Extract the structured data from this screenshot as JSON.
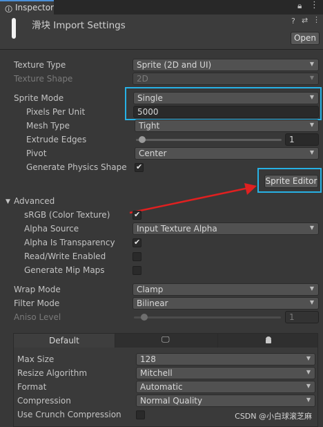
{
  "tab": {
    "label": "Inspector",
    "icon": "info-icon"
  },
  "header": {
    "title": "滑块 Import Settings",
    "open_label": "Open",
    "help_icon": "?",
    "settings_icon": "⇄",
    "menu_icon": "⋮"
  },
  "general": [
    {
      "label": "Texture Type",
      "value": "Sprite (2D and UI)"
    },
    {
      "label": "Texture Shape",
      "value": "2D"
    }
  ],
  "sprite": {
    "mode_label": "Sprite Mode",
    "mode_value": "Single",
    "ppu_label": "Pixels Per Unit",
    "ppu_value": "5000",
    "mesh_label": "Mesh Type",
    "mesh_value": "Tight",
    "extrude_label": "Extrude Edges",
    "extrude_value": "1",
    "extrude_level": 0.05,
    "pivot_label": "Pivot",
    "pivot_value": "Center",
    "physics_label": "Generate Physics Shape",
    "physics_checked": true,
    "editor_button": "Sprite Editor"
  },
  "advanced": {
    "label": "Advanced",
    "srgb_label": "sRGB (Color Texture)",
    "srgb_checked": true,
    "alpha_source_label": "Alpha Source",
    "alpha_source_value": "Input Texture Alpha",
    "alpha_transp_label": "Alpha Is Transparency",
    "alpha_transp_checked": true,
    "rw_label": "Read/Write Enabled",
    "rw_checked": false,
    "mip_label": "Generate Mip Maps",
    "mip_checked": false
  },
  "wrap": {
    "wrap_label": "Wrap Mode",
    "wrap_value": "Clamp",
    "filter_label": "Filter Mode",
    "filter_value": "Bilinear",
    "aniso_label": "Aniso Level",
    "aniso_value": "1",
    "aniso_level": 0.1
  },
  "platform": {
    "tabs": [
      {
        "label": "Default"
      },
      {
        "icon": "monitor-icon"
      },
      {
        "icon": "android-icon"
      }
    ],
    "max_size_label": "Max Size",
    "max_size_value": "128",
    "resize_label": "Resize Algorithm",
    "resize_value": "Mitchell",
    "format_label": "Format",
    "format_value": "Automatic",
    "compression_label": "Compression",
    "compression_value": "Normal Quality",
    "crunch_label": "Use Crunch Compression",
    "crunch_checked": false
  },
  "watermark": "CSDN @小白球滚芝麻",
  "colors": {
    "highlight": "#27b2e6",
    "arrow": "#e02020",
    "background": "#383838"
  }
}
